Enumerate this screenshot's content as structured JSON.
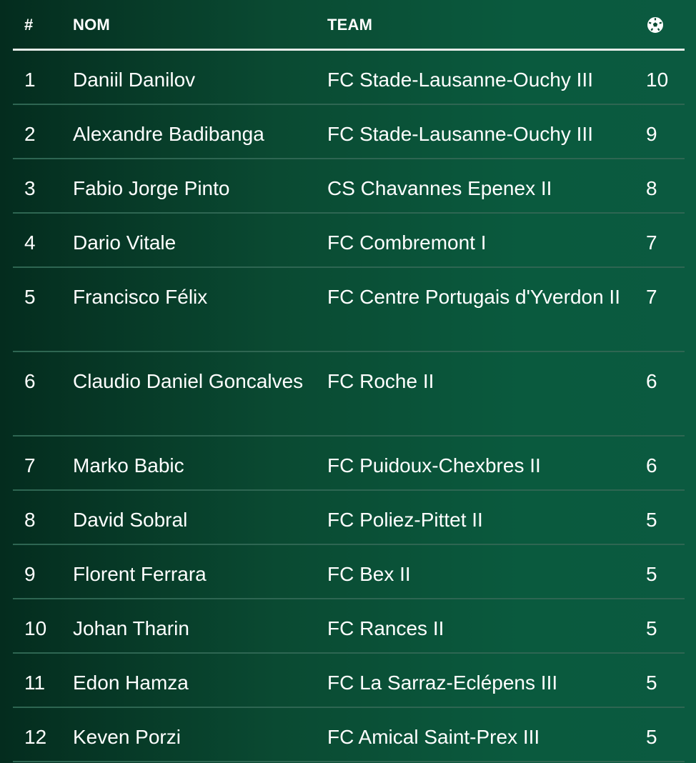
{
  "header": {
    "rank": "#",
    "name": "NOM",
    "team": "TEAM",
    "goals_icon": "soccer-ball-icon"
  },
  "rows": [
    {
      "rank": "1",
      "name": "Daniil Danilov",
      "team": "FC Stade-Lausanne-Ouchy III",
      "goals": "10"
    },
    {
      "rank": "2",
      "name": "Alexandre Badibanga",
      "team": "FC Stade-Lausanne-Ouchy III",
      "goals": "9"
    },
    {
      "rank": "3",
      "name": "Fabio Jorge Pinto",
      "team": "CS Chavannes Epenex II",
      "goals": "8"
    },
    {
      "rank": "4",
      "name": "Dario Vitale",
      "team": "FC Combremont I",
      "goals": "7"
    },
    {
      "rank": "5",
      "name": "Francisco Félix",
      "team": "FC Centre Portugais d'Yverdon II",
      "goals": "7"
    },
    {
      "rank": "6",
      "name": "Claudio Daniel Goncalves",
      "team": "FC Roche II",
      "goals": "6"
    },
    {
      "rank": "7",
      "name": "Marko Babic",
      "team": "FC Puidoux-Chexbres II",
      "goals": "6"
    },
    {
      "rank": "8",
      "name": "David Sobral",
      "team": "FC Poliez-Pittet II",
      "goals": "5"
    },
    {
      "rank": "9",
      "name": "Florent Ferrara",
      "team": "FC Bex II",
      "goals": "5"
    },
    {
      "rank": "10",
      "name": "Johan Tharin",
      "team": "FC Rances II",
      "goals": "5"
    },
    {
      "rank": "11",
      "name": "Edon Hamza",
      "team": "FC La Sarraz-Eclépens III",
      "goals": "5"
    },
    {
      "rank": "12",
      "name": "Keven Porzi",
      "team": "FC Amical Saint-Prex III",
      "goals": "5"
    }
  ]
}
